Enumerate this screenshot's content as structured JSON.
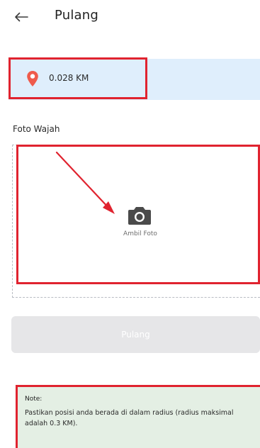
{
  "header": {
    "back_icon": "arrow-left-icon",
    "title": "Pulang"
  },
  "location": {
    "icon": "map-pin-icon",
    "distance": "0.028 KM"
  },
  "photo": {
    "section_label": "Foto Wajah",
    "icon": "camera-icon",
    "label": "Ambil Foto"
  },
  "submit": {
    "label": "Pulang",
    "state": "disabled"
  },
  "note": {
    "title": "Note:",
    "text": "Pastikan posisi anda berada di dalam radius (radius maksimal adalah 0.3 KM)."
  },
  "colors": {
    "accent_red": "#e0232f",
    "pin_orange": "#ef5b4c",
    "location_bg": "#dfeefc",
    "note_bg": "#e4efe4",
    "button_disabled": "#e6e6e8"
  }
}
